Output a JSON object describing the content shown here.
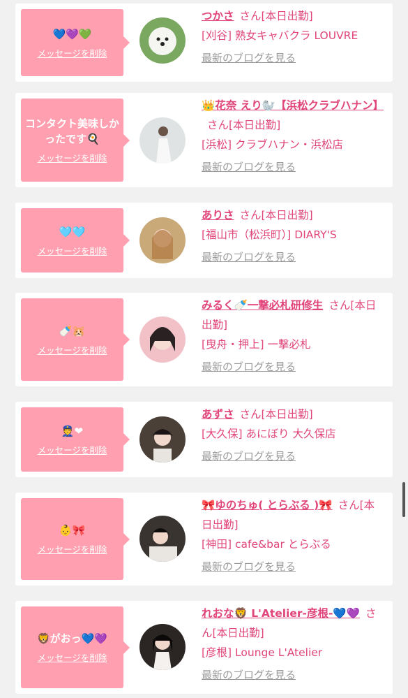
{
  "delete_label": "メッセージを削除",
  "san_label": "さん",
  "blog_label": "最新のブログを見る",
  "cards": [
    {
      "message": "💙💜💚",
      "name": "つかさ",
      "status": "[本日出勤]",
      "shop": "[刈谷] 熟女キャバクラ LOUVRE"
    },
    {
      "message": "コンタクト美味しかったです🍳",
      "name": "👑花奈 えり🦭【浜松クラブハナン】",
      "status": "[本日出勤]",
      "shop": "[浜松] クラブハナン・浜松店"
    },
    {
      "message": "🩵🩵",
      "name": "ありさ",
      "status": "[本日出勤]",
      "shop": "[福山市（松浜町）] DIARY'S"
    },
    {
      "message": "🍼🐹",
      "name": "みるく🍼一撃必札研修生",
      "status": "[本日出勤]",
      "shop": "[曳舟・押上] 一撃必札"
    },
    {
      "message": "👮❤",
      "name": "あずさ",
      "status": "[本日出勤]",
      "shop": "[大久保] あにぼり 大久保店"
    },
    {
      "message": "👶🎀",
      "name": "🎀ゆのちゅ( とらぶる )🎀",
      "status": "[本日出勤]",
      "shop": "[神田] cafe&bar とらぶる"
    },
    {
      "message": "🦁がおっ💙💜",
      "name": "れおな🦁 L'Atelier-彦根-💙💜",
      "status": "[本日出勤]",
      "shop": "[彦根] Lounge L'Atelier"
    }
  ]
}
